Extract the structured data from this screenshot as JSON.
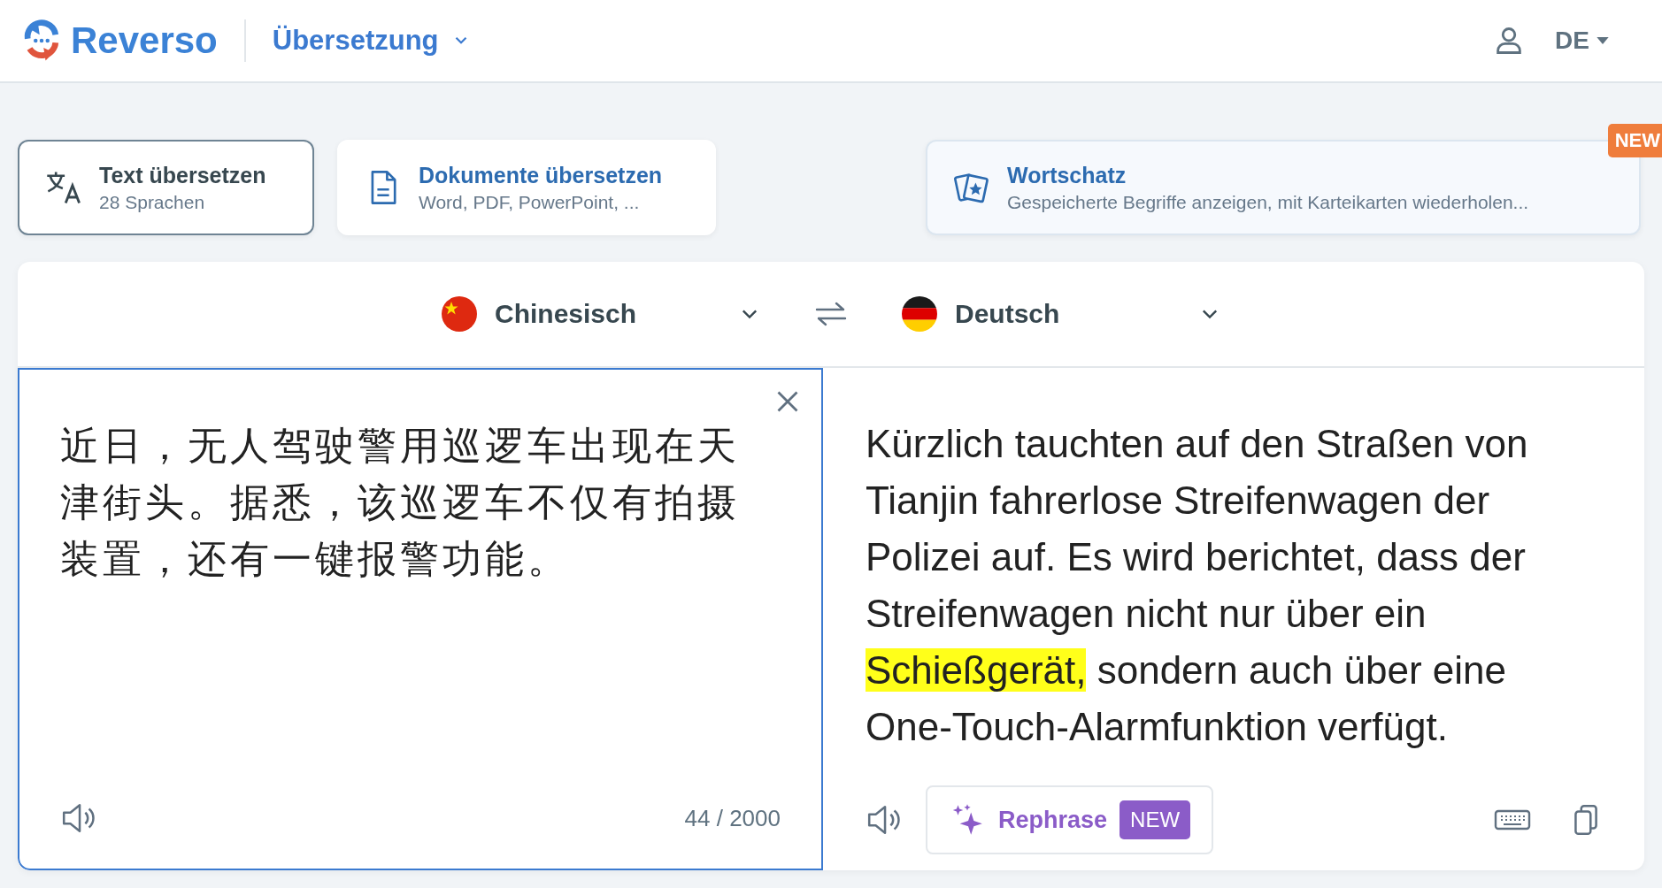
{
  "header": {
    "logo": "Reverso",
    "menu": "Übersetzung",
    "language": "DE"
  },
  "tabs": [
    {
      "kind": "text",
      "title": "Text übersetzen",
      "subtitle": "28 Sprachen",
      "selected": true
    },
    {
      "kind": "document",
      "title": "Dokumente übersetzen",
      "subtitle": "Word, PDF, PowerPoint, ...",
      "selected": false
    },
    {
      "kind": "vocabulary",
      "title": "Wortschatz",
      "subtitle": "Gespeicherte Begriffe anzeigen, mit Karteikarten wiederholen...",
      "badge": "NEW",
      "selected": false
    }
  ],
  "languages": {
    "source": {
      "name": "Chinesisch",
      "kind": "cn"
    },
    "target": {
      "name": "Deutsch",
      "kind": "de"
    }
  },
  "source": {
    "text": "近日，无人驾驶警用巡逻车出现在天津街头。据悉，该巡逻车不仅有拍摄装置，还有一键报警功能。",
    "counter": "44 / 2000"
  },
  "output": {
    "segments": [
      {
        "text": "Kürzlich tauchten auf den Straßen von Tianjin fahrerlose Streifenwagen der Polizei auf. Es wird berichtet, dass der Streifenwagen nicht nur über ein ",
        "highlighted": false
      },
      {
        "text": "Schießgerät,",
        "highlighted": true
      },
      {
        "text": " sondern auch über eine One-Touch-Alarmfunktion verfügt.",
        "highlighted": false
      }
    ],
    "rephrase": "Rephrase",
    "rephrase_badge": "NEW"
  }
}
